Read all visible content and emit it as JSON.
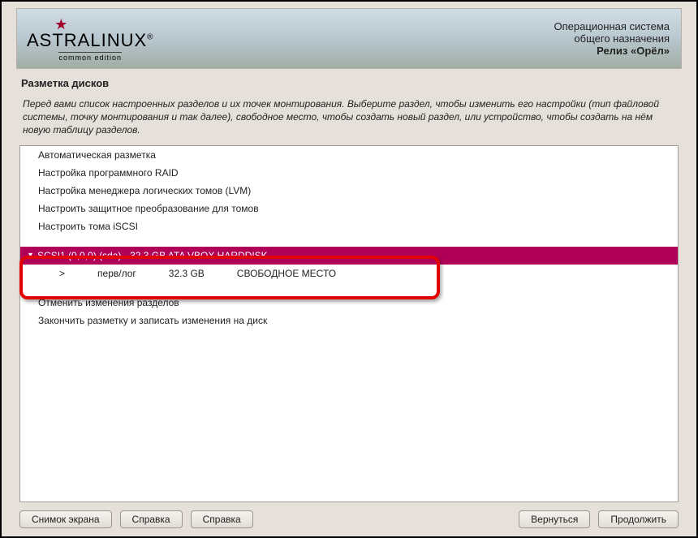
{
  "logo": {
    "main": "ASTRALINUX",
    "reg": "®",
    "sub": "common edition"
  },
  "brand": {
    "line1": "Операционная система",
    "line2": "общего назначения",
    "line3": "Релиз «Орёл»"
  },
  "title": "Разметка дисков",
  "description": "Перед вами список настроенных разделов и их точек монтирования. Выберите раздел, чтобы изменить его настройки (тип файловой системы, точку монтирования и так далее), свободное место, чтобы создать новый раздел, или устройство, чтобы создать на нём новую таблицу разделов.",
  "options": {
    "auto": "Автоматическая разметка",
    "raid": "Настройка программного RAID",
    "lvm": "Настройка менеджера логических томов (LVM)",
    "crypt": "Настроить защитное преобразование для томов",
    "iscsi": "Настроить тома iSCSI"
  },
  "disk": {
    "header": "SCSI1 (0,0,0) (sda) - 32.3 GB ATA VBOX HARDDISK",
    "partition": {
      "marker": ">",
      "type": "перв/лог",
      "size": "32.3 GB",
      "label": "СВОБОДНОЕ МЕСТО"
    }
  },
  "actions": {
    "undo": "Отменить изменения разделов",
    "finish": "Закончить разметку и записать изменения на диск"
  },
  "buttons": {
    "screenshot": "Снимок экрана",
    "help1": "Справка",
    "help2": "Справка",
    "back": "Вернуться",
    "continue": "Продолжить"
  }
}
